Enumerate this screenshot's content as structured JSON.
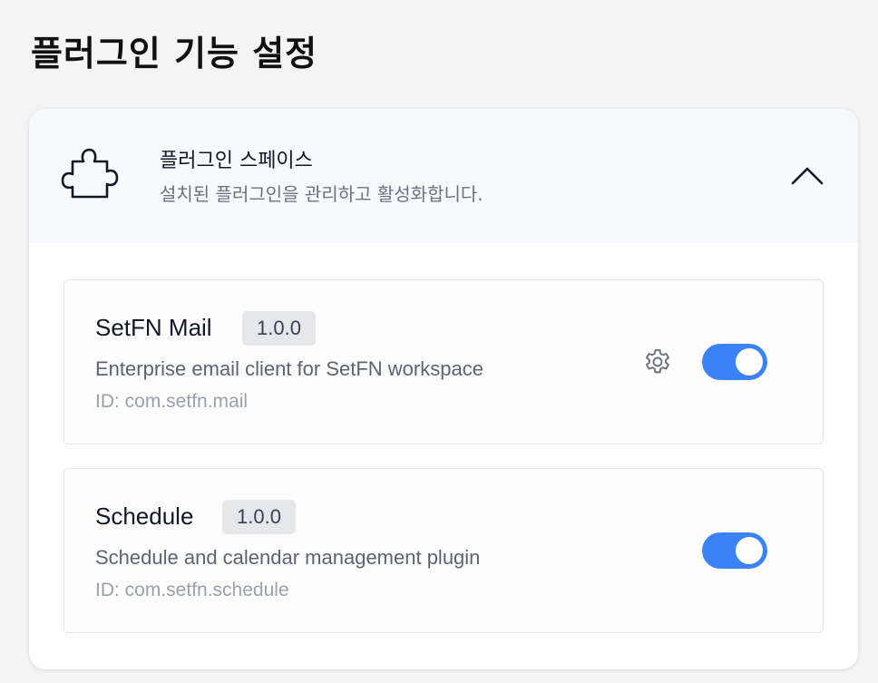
{
  "page": {
    "title": "플러그인 기능 설정"
  },
  "section": {
    "icon": "puzzle-icon",
    "title": "플러그인 스페이스",
    "subtitle": "설치된 플러그인을 관리하고 활성화합니다.",
    "expanded": true,
    "collapse_icon": "chevron-up-icon"
  },
  "plugins": [
    {
      "name": "SetFN Mail",
      "version": "1.0.0",
      "description": "Enterprise email client for SetFN workspace",
      "id_text": "ID: com.setfn.mail",
      "has_settings": true,
      "settings_icon": "gear-icon",
      "enabled": true
    },
    {
      "name": "Schedule",
      "version": "1.0.0",
      "description": "Schedule and calendar management plugin",
      "id_text": "ID: com.setfn.schedule",
      "has_settings": false,
      "enabled": true
    }
  ],
  "colors": {
    "toggle_on": "#3b82f6",
    "header_bg": "#f7f9fc",
    "version_badge_bg": "#e5e7eb"
  }
}
